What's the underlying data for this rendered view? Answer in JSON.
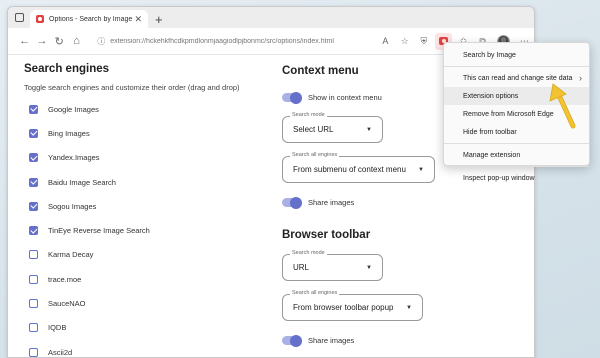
{
  "browser": {
    "tab_title": "Options - Search by Image",
    "tab_close": "✕",
    "new_tab": "+",
    "url": "extension://hckehkfhcdkpmdlonmjaagiodlpjbonmc/src/options/index.html"
  },
  "left": {
    "title": "Search engines",
    "subtitle": "Toggle search engines and customize their order (drag and drop)",
    "engines": [
      {
        "name": "Google Images",
        "checked": true
      },
      {
        "name": "Bing Images",
        "checked": true
      },
      {
        "name": "Yandex.Images",
        "checked": true
      },
      {
        "name": "Baidu Image Search",
        "checked": true
      },
      {
        "name": "Sogou Images",
        "checked": true
      },
      {
        "name": "TinEye Reverse Image Search",
        "checked": true
      },
      {
        "name": "Karma Decay",
        "checked": false
      },
      {
        "name": "trace.moe",
        "checked": false
      },
      {
        "name": "SauceNAO",
        "checked": false
      },
      {
        "name": "IQDB",
        "checked": false
      },
      {
        "name": "Ascii2d",
        "checked": false
      }
    ]
  },
  "context_menu": {
    "title": "Context menu",
    "show_label": "Show in context menu",
    "search_mode_label": "Search mode",
    "search_mode_value": "Select URL",
    "all_engines_label": "Search all engines",
    "all_engines_value": "From submenu of context menu",
    "share_label": "Share images"
  },
  "browser_toolbar": {
    "title": "Browser toolbar",
    "search_mode_label": "Search mode",
    "search_mode_value": "URL",
    "all_engines_label": "Search all engines",
    "all_engines_value": "From browser toolbar popup",
    "share_label": "Share images"
  },
  "ext_menu": {
    "items": [
      "Search by Image",
      "This can read and change site data",
      "Extension options",
      "Remove from Microsoft Edge",
      "Hide from toolbar",
      "Manage extension",
      "Inspect pop-up window"
    ],
    "highlighted_index": 2,
    "submenu_chevron": "›"
  },
  "colors": {
    "accent": "#6470c9",
    "annotation_arrow": "#f2c230",
    "extension_icon": "#e0443e"
  }
}
